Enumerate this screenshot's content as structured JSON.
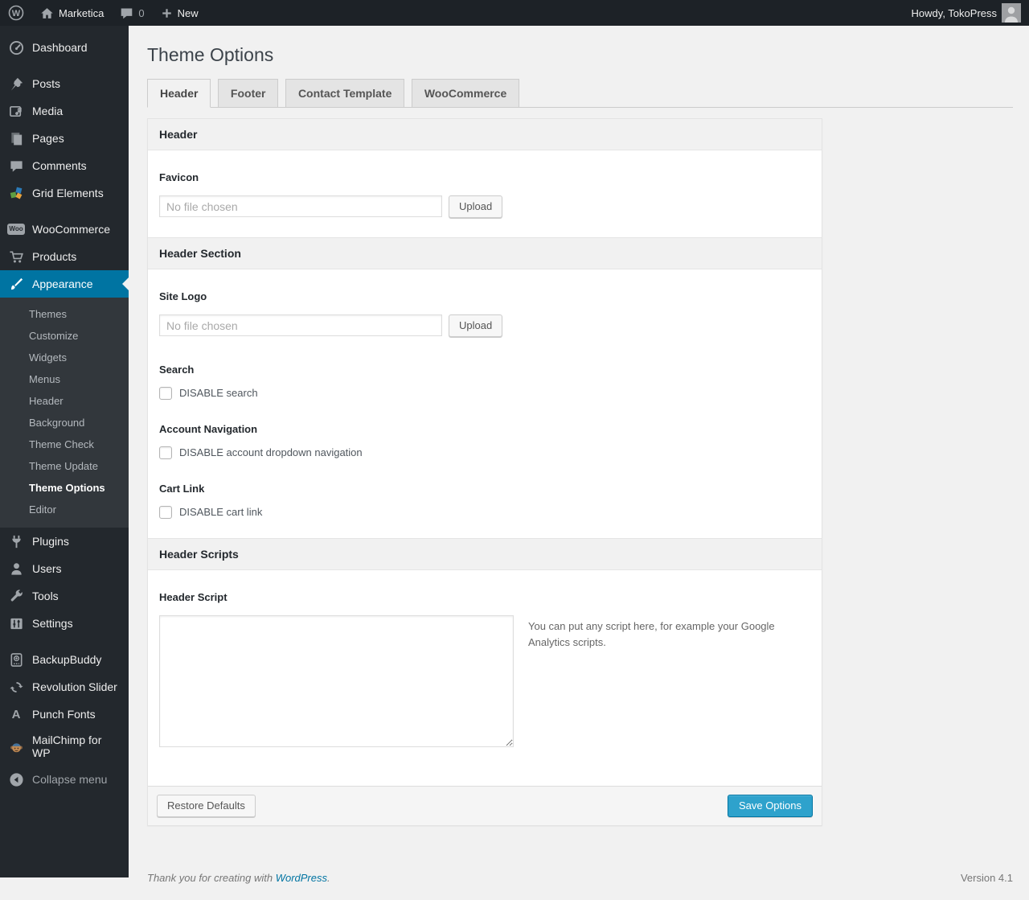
{
  "admin_bar": {
    "site_name": "Marketica",
    "comments_count": "0",
    "new_label": "New",
    "howdy": "Howdy, TokoPress"
  },
  "icons": {
    "wp_logo_letter": "W",
    "woo_badge": "Woo",
    "punch_fonts_letter": "A"
  },
  "sidebar": {
    "items": [
      {
        "label": "Dashboard"
      },
      {
        "label": "Posts"
      },
      {
        "label": "Media"
      },
      {
        "label": "Pages"
      },
      {
        "label": "Comments"
      },
      {
        "label": "Grid Elements"
      },
      {
        "label": "WooCommerce"
      },
      {
        "label": "Products"
      },
      {
        "label": "Appearance"
      },
      {
        "label": "Plugins"
      },
      {
        "label": "Users"
      },
      {
        "label": "Tools"
      },
      {
        "label": "Settings"
      },
      {
        "label": "BackupBuddy"
      },
      {
        "label": "Revolution Slider"
      },
      {
        "label": "Punch Fonts"
      },
      {
        "label": "MailChimp for WP"
      }
    ],
    "appearance_submenu": [
      "Themes",
      "Customize",
      "Widgets",
      "Menus",
      "Header",
      "Background",
      "Theme Check",
      "Theme Update",
      "Theme Options",
      "Editor"
    ],
    "active_submenu_item": "Theme Options",
    "collapse_label": "Collapse menu"
  },
  "main": {
    "title": "Theme Options",
    "tabs": [
      {
        "label": "Header",
        "active": true
      },
      {
        "label": "Footer",
        "active": false
      },
      {
        "label": "Contact Template",
        "active": false
      },
      {
        "label": "WooCommerce",
        "active": false
      }
    ]
  },
  "form": {
    "sections": {
      "header": {
        "title": "Header"
      },
      "header_section": {
        "title": "Header Section"
      },
      "header_scripts": {
        "title": "Header Scripts"
      }
    },
    "fields": {
      "favicon": {
        "label": "Favicon",
        "placeholder": "No file chosen",
        "button": "Upload"
      },
      "site_logo": {
        "label": "Site Logo",
        "placeholder": "No file chosen",
        "button": "Upload"
      },
      "search": {
        "label": "Search",
        "checkbox_label": "DISABLE search",
        "checked": false
      },
      "account_nav": {
        "label": "Account Navigation",
        "checkbox_label": "DISABLE account dropdown navigation",
        "checked": false
      },
      "cart_link": {
        "label": "Cart Link",
        "checkbox_label": "DISABLE cart link",
        "checked": false
      },
      "header_script": {
        "label": "Header Script",
        "value": "",
        "note": "You can put any script here, for example your Google Analytics scripts."
      }
    },
    "footer": {
      "restore_label": "Restore Defaults",
      "save_label": "Save Options"
    }
  },
  "footer": {
    "thanks_prefix": "Thank you for creating with ",
    "wordpress_link": "WordPress",
    "thanks_suffix": ".",
    "version": "Version 4.1"
  },
  "colors": {
    "menu_highlight": "#0074a2",
    "primary_button": "#2ea2cc",
    "admin_bar_bg": "#1d2227",
    "sidebar_bg": "#23282d",
    "submenu_bg": "#32373c",
    "page_bg": "#f1f1f1"
  }
}
